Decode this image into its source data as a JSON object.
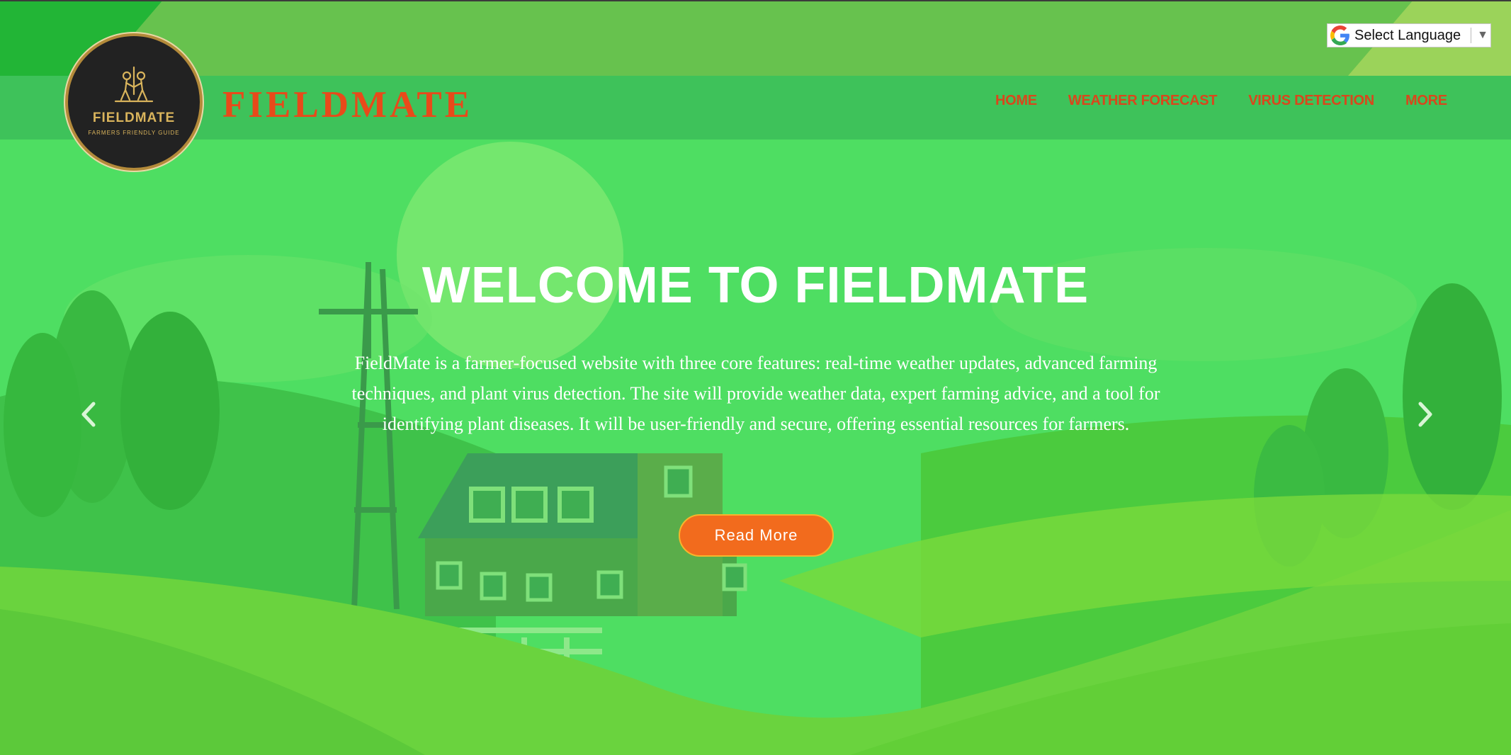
{
  "translate": {
    "label": "Select Language",
    "icon": "google-g-icon",
    "arrow": "▼"
  },
  "brand": {
    "site_title": "FIELDMATE",
    "logo_name": "FIELDMATE",
    "logo_tagline": "FARMERS FRIENDLY GUIDE"
  },
  "nav": {
    "items": [
      {
        "label": "HOME"
      },
      {
        "label": "WEATHER FORECAST"
      },
      {
        "label": "VIRUS DETECTION"
      },
      {
        "label": "MORE"
      }
    ]
  },
  "hero": {
    "headline": "WELCOME TO FIELDMATE",
    "description": "FieldMate is a farmer-focused website with three core features: real-time weather updates, advanced farming techniques, and plant virus detection. The site will provide weather data, expert farming advice, and a tool for identifying plant diseases. It will be user-friendly and secure, offering essential resources for farmers.",
    "button": "Read More",
    "prev_icon": "chevron-left-icon",
    "next_icon": "chevron-right-icon"
  },
  "colors": {
    "accent_orange": "#e84a1a",
    "button_orange": "#f26b1d",
    "hero_green": "#4fd65f",
    "navbar_green": "#3ec25a",
    "topbar_green": "#67c24e"
  }
}
